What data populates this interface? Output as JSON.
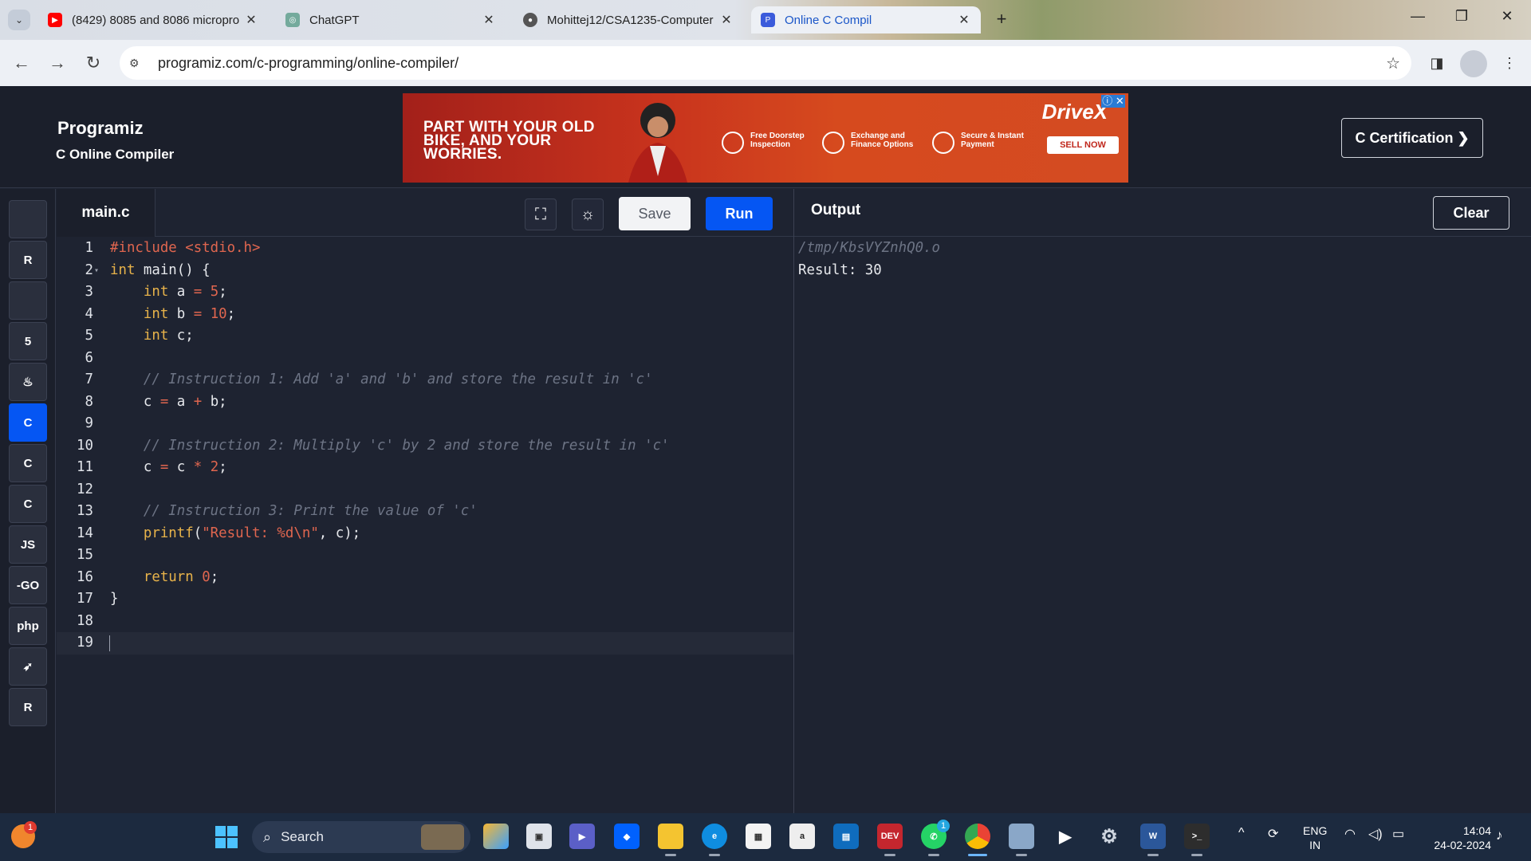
{
  "browser": {
    "tabs": [
      {
        "title": "(8429) 8085 and 8086 micropro",
        "favicon": "youtube-icon",
        "active": false
      },
      {
        "title": "ChatGPT",
        "favicon": "chatgpt-icon",
        "active": false
      },
      {
        "title": "Mohittej12/CSA1235-Computer",
        "favicon": "github-icon",
        "active": false
      },
      {
        "title": "Online C Compil",
        "favicon": "programiz-icon",
        "active": true
      }
    ],
    "new_tab_label": "+",
    "url": "programiz.com/c-programming/online-compiler/"
  },
  "header": {
    "brand": "Programiz",
    "subtitle": "C Online Compiler",
    "cert_button": "C Certification ❯"
  },
  "ad": {
    "headline": "PART WITH YOUR OLD BIKE, AND YOUR WORRIES.",
    "features": [
      "Free Doorstep Inspection",
      "Exchange and Finance Options",
      "Secure & Instant Payment"
    ],
    "brand": "DriveX",
    "cta": "SELL NOW"
  },
  "languages": [
    {
      "name": "python-icon",
      "glyph": "",
      "active": false
    },
    {
      "name": "r-icon",
      "glyph": "R",
      "active": false
    },
    {
      "name": "sql-icon",
      "glyph": "",
      "active": false
    },
    {
      "name": "html-icon",
      "glyph": "5",
      "active": false
    },
    {
      "name": "java-icon",
      "glyph": "♨",
      "active": false
    },
    {
      "name": "c-icon",
      "glyph": "C",
      "active": true
    },
    {
      "name": "cpp-icon",
      "glyph": "C",
      "active": false
    },
    {
      "name": "csharp-icon",
      "glyph": "C",
      "active": false
    },
    {
      "name": "js-icon",
      "glyph": "JS",
      "active": false
    },
    {
      "name": "go-icon",
      "glyph": "-GO",
      "active": false
    },
    {
      "name": "php-icon",
      "glyph": "php",
      "active": false
    },
    {
      "name": "swift-icon",
      "glyph": "➶",
      "active": false
    },
    {
      "name": "rust-icon",
      "glyph": "R",
      "active": false
    }
  ],
  "editor": {
    "filename": "main.c",
    "save_label": "Save",
    "run_label": "Run",
    "lines": [
      [
        {
          "t": "pre",
          "v": "#include "
        },
        {
          "t": "str",
          "v": "<stdio.h>"
        }
      ],
      [
        {
          "t": "kw",
          "v": "int"
        },
        {
          "t": "",
          "v": " main() {"
        }
      ],
      [
        {
          "t": "",
          "v": "    "
        },
        {
          "t": "kw",
          "v": "int"
        },
        {
          "t": "",
          "v": " a "
        },
        {
          "t": "op",
          "v": "="
        },
        {
          "t": "",
          "v": " "
        },
        {
          "t": "num",
          "v": "5"
        },
        {
          "t": "",
          "v": ";"
        }
      ],
      [
        {
          "t": "",
          "v": "    "
        },
        {
          "t": "kw",
          "v": "int"
        },
        {
          "t": "",
          "v": " b "
        },
        {
          "t": "op",
          "v": "="
        },
        {
          "t": "",
          "v": " "
        },
        {
          "t": "num",
          "v": "10"
        },
        {
          "t": "",
          "v": ";"
        }
      ],
      [
        {
          "t": "",
          "v": "    "
        },
        {
          "t": "kw",
          "v": "int"
        },
        {
          "t": "",
          "v": " c;"
        }
      ],
      [],
      [
        {
          "t": "",
          "v": "    "
        },
        {
          "t": "cm",
          "v": "// Instruction 1: Add 'a' and 'b' and store the result in 'c'"
        }
      ],
      [
        {
          "t": "",
          "v": "    c "
        },
        {
          "t": "op",
          "v": "="
        },
        {
          "t": "",
          "v": " a "
        },
        {
          "t": "op",
          "v": "+"
        },
        {
          "t": "",
          "v": " b;"
        }
      ],
      [],
      [
        {
          "t": "",
          "v": "    "
        },
        {
          "t": "cm",
          "v": "// Instruction 2: Multiply 'c' by 2 and store the result in 'c'"
        }
      ],
      [
        {
          "t": "",
          "v": "    c "
        },
        {
          "t": "op",
          "v": "="
        },
        {
          "t": "",
          "v": " c "
        },
        {
          "t": "op",
          "v": "*"
        },
        {
          "t": "",
          "v": " "
        },
        {
          "t": "num",
          "v": "2"
        },
        {
          "t": "",
          "v": ";"
        }
      ],
      [],
      [
        {
          "t": "",
          "v": "    "
        },
        {
          "t": "cm",
          "v": "// Instruction 3: Print the value of 'c'"
        }
      ],
      [
        {
          "t": "",
          "v": "    "
        },
        {
          "t": "kw",
          "v": "printf"
        },
        {
          "t": "",
          "v": "("
        },
        {
          "t": "str",
          "v": "\"Result: %d\\n\""
        },
        {
          "t": "",
          "v": ", c);"
        }
      ],
      [],
      [
        {
          "t": "",
          "v": "    "
        },
        {
          "t": "kw",
          "v": "return"
        },
        {
          "t": "",
          "v": " "
        },
        {
          "t": "num",
          "v": "0"
        },
        {
          "t": "",
          "v": ";"
        }
      ],
      [
        {
          "t": "",
          "v": "}"
        }
      ],
      [],
      []
    ],
    "current_line": 19
  },
  "output": {
    "title": "Output",
    "clear_label": "Clear",
    "path": "/tmp/KbsVYZnhQ0.o",
    "result": "Result: 30"
  },
  "taskbar": {
    "search_placeholder": "Search",
    "weather_badge": "1",
    "whatsapp_badge": "1",
    "lang_line1": "ENG",
    "lang_line2": "IN",
    "time": "14:04",
    "date": "24-02-2024"
  },
  "colors": {
    "accent": "#0556f3",
    "bg": "#1e2331",
    "keyword": "#e8b34a",
    "literal": "#e0664f",
    "comment": "#6d7485"
  }
}
